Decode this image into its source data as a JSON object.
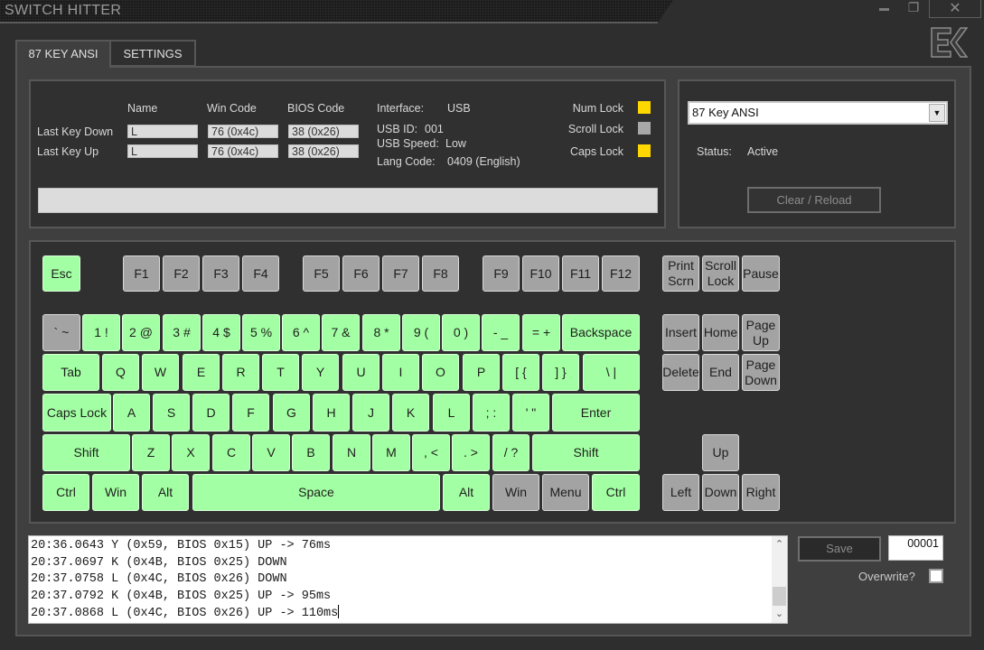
{
  "window": {
    "title": "SWITCH HITTER",
    "minimize_icon": "minimize-icon",
    "restore_icon": "restore-icon",
    "close_icon": "close-icon",
    "close_glyph": "✕",
    "restore_glyph": "❐",
    "logo": "EK"
  },
  "tabs": [
    {
      "label": "87 KEY ANSI",
      "active": true
    },
    {
      "label": "SETTINGS",
      "active": false
    }
  ],
  "info": {
    "columns": [
      "Name",
      "Win Code",
      "BIOS Code"
    ],
    "rows": [
      {
        "label": "Last Key Down",
        "name": "L",
        "win_code": "76 (0x4c)",
        "bios_code": "38 (0x26)"
      },
      {
        "label": "Last Key Up",
        "name": "L",
        "win_code": "76 (0x4c)",
        "bios_code": "38 (0x26)"
      }
    ],
    "interface_label": "Interface:",
    "interface_value": "USB",
    "usb_id_label": "USB ID:",
    "usb_id_value": "001",
    "usb_speed_label": "USB Speed:",
    "usb_speed_value": "Low",
    "lang_code_label": "Lang Code:",
    "lang_code_value": "0409 (English)",
    "locks": [
      {
        "label": "Num Lock",
        "on": true,
        "color": "#ffd700"
      },
      {
        "label": "Scroll Lock",
        "on": false,
        "color": "#a8a8a8"
      },
      {
        "label": "Caps Lock",
        "on": true,
        "color": "#ffd700"
      }
    ],
    "progress": 0
  },
  "device": {
    "layout_selected": "87 Key ANSI",
    "status_label": "Status:",
    "status_value": "Active",
    "clear_reload_label": "Clear / Reload"
  },
  "colors": {
    "key_tested": "#a3ffa3",
    "key_untested": "#a3a3a3",
    "lock_on": "#ffd700",
    "lock_off": "#a8a8a8"
  },
  "keyboard": {
    "keys": [
      {
        "id": "esc",
        "label": "Esc",
        "state": "tested"
      },
      {
        "id": "f1",
        "label": "F1",
        "state": "untested"
      },
      {
        "id": "f2",
        "label": "F2",
        "state": "untested"
      },
      {
        "id": "f3",
        "label": "F3",
        "state": "untested"
      },
      {
        "id": "f4",
        "label": "F4",
        "state": "untested"
      },
      {
        "id": "f5",
        "label": "F5",
        "state": "untested"
      },
      {
        "id": "f6",
        "label": "F6",
        "state": "untested"
      },
      {
        "id": "f7",
        "label": "F7",
        "state": "untested"
      },
      {
        "id": "f8",
        "label": "F8",
        "state": "untested"
      },
      {
        "id": "f9",
        "label": "F9",
        "state": "untested"
      },
      {
        "id": "f10",
        "label": "F10",
        "state": "untested"
      },
      {
        "id": "f11",
        "label": "F11",
        "state": "untested"
      },
      {
        "id": "f12",
        "label": "F12",
        "state": "untested"
      },
      {
        "id": "printscrn",
        "label": "Print Scrn",
        "state": "untested"
      },
      {
        "id": "scrolllock",
        "label": "Scroll Lock",
        "state": "untested"
      },
      {
        "id": "pause",
        "label": "Pause",
        "state": "untested"
      },
      {
        "id": "grave",
        "label": "` ~",
        "state": "untested"
      },
      {
        "id": "1",
        "label": "1 !",
        "state": "tested"
      },
      {
        "id": "2",
        "label": "2 @",
        "state": "tested"
      },
      {
        "id": "3",
        "label": "3 #",
        "state": "tested"
      },
      {
        "id": "4",
        "label": "4 $",
        "state": "tested"
      },
      {
        "id": "5",
        "label": "5 %",
        "state": "tested"
      },
      {
        "id": "6",
        "label": "6 ^",
        "state": "tested"
      },
      {
        "id": "7",
        "label": "7 &",
        "state": "tested"
      },
      {
        "id": "8",
        "label": "8 *",
        "state": "tested"
      },
      {
        "id": "9",
        "label": "9 (",
        "state": "tested"
      },
      {
        "id": "0",
        "label": "0 )",
        "state": "tested"
      },
      {
        "id": "minus",
        "label": "- _",
        "state": "tested"
      },
      {
        "id": "equal",
        "label": "= +",
        "state": "tested"
      },
      {
        "id": "backspace",
        "label": "Backspace",
        "state": "tested"
      },
      {
        "id": "insert",
        "label": "Insert",
        "state": "untested"
      },
      {
        "id": "home",
        "label": "Home",
        "state": "untested"
      },
      {
        "id": "pageup",
        "label": "Page Up",
        "state": "untested"
      },
      {
        "id": "tab",
        "label": "Tab",
        "state": "tested"
      },
      {
        "id": "q",
        "label": "Q",
        "state": "tested"
      },
      {
        "id": "w",
        "label": "W",
        "state": "tested"
      },
      {
        "id": "e",
        "label": "E",
        "state": "tested"
      },
      {
        "id": "r",
        "label": "R",
        "state": "tested"
      },
      {
        "id": "t",
        "label": "T",
        "state": "tested"
      },
      {
        "id": "y",
        "label": "Y",
        "state": "tested"
      },
      {
        "id": "u",
        "label": "U",
        "state": "tested"
      },
      {
        "id": "i",
        "label": "I",
        "state": "tested"
      },
      {
        "id": "o",
        "label": "O",
        "state": "tested"
      },
      {
        "id": "p",
        "label": "P",
        "state": "tested"
      },
      {
        "id": "lbracket",
        "label": "[ {",
        "state": "tested"
      },
      {
        "id": "rbracket",
        "label": "] }",
        "state": "tested"
      },
      {
        "id": "backslash",
        "label": "\\ |",
        "state": "tested"
      },
      {
        "id": "delete",
        "label": "Delete",
        "state": "untested"
      },
      {
        "id": "end",
        "label": "End",
        "state": "untested"
      },
      {
        "id": "pagedown",
        "label": "Page Down",
        "state": "untested"
      },
      {
        "id": "capslock",
        "label": "Caps Lock",
        "state": "tested"
      },
      {
        "id": "a",
        "label": "A",
        "state": "tested"
      },
      {
        "id": "s",
        "label": "S",
        "state": "tested"
      },
      {
        "id": "d",
        "label": "D",
        "state": "tested"
      },
      {
        "id": "f",
        "label": "F",
        "state": "tested"
      },
      {
        "id": "g",
        "label": "G",
        "state": "tested"
      },
      {
        "id": "h",
        "label": "H",
        "state": "tested"
      },
      {
        "id": "j",
        "label": "J",
        "state": "tested"
      },
      {
        "id": "k",
        "label": "K",
        "state": "tested"
      },
      {
        "id": "l",
        "label": "L",
        "state": "tested"
      },
      {
        "id": "semicolon",
        "label": "; :",
        "state": "tested"
      },
      {
        "id": "quote",
        "label": "' \"",
        "state": "tested"
      },
      {
        "id": "enter",
        "label": "Enter",
        "state": "tested"
      },
      {
        "id": "lshift",
        "label": "Shift",
        "state": "tested"
      },
      {
        "id": "z",
        "label": "Z",
        "state": "tested"
      },
      {
        "id": "x",
        "label": "X",
        "state": "tested"
      },
      {
        "id": "c",
        "label": "C",
        "state": "tested"
      },
      {
        "id": "v",
        "label": "V",
        "state": "tested"
      },
      {
        "id": "b",
        "label": "B",
        "state": "tested"
      },
      {
        "id": "n",
        "label": "N",
        "state": "tested"
      },
      {
        "id": "m",
        "label": "M",
        "state": "tested"
      },
      {
        "id": "comma",
        "label": ", <",
        "state": "tested"
      },
      {
        "id": "period",
        "label": ". >",
        "state": "tested"
      },
      {
        "id": "slash",
        "label": "/ ?",
        "state": "tested"
      },
      {
        "id": "rshift",
        "label": "Shift",
        "state": "tested"
      },
      {
        "id": "up",
        "label": "Up",
        "state": "untested"
      },
      {
        "id": "lctrl",
        "label": "Ctrl",
        "state": "tested"
      },
      {
        "id": "lwin",
        "label": "Win",
        "state": "tested"
      },
      {
        "id": "lalt",
        "label": "Alt",
        "state": "tested"
      },
      {
        "id": "space",
        "label": "Space",
        "state": "tested"
      },
      {
        "id": "ralt",
        "label": "Alt",
        "state": "tested"
      },
      {
        "id": "rwin",
        "label": "Win",
        "state": "untested"
      },
      {
        "id": "menu",
        "label": "Menu",
        "state": "untested"
      },
      {
        "id": "rctrl",
        "label": "Ctrl",
        "state": "tested"
      },
      {
        "id": "left",
        "label": "Left",
        "state": "untested"
      },
      {
        "id": "down",
        "label": "Down",
        "state": "untested"
      },
      {
        "id": "right",
        "label": "Right",
        "state": "untested"
      }
    ]
  },
  "log": {
    "lines": [
      "20:36.0643 Y (0x59, BIOS 0x15) UP -> 76ms",
      "20:37.0697 K (0x4B, BIOS 0x25) DOWN",
      "20:37.0758 L (0x4C, BIOS 0x26) DOWN",
      "20:37.0792 K (0x4B, BIOS 0x25) UP -> 95ms",
      "20:37.0868 L (0x4C, BIOS 0x26) UP -> 110ms"
    ],
    "scroll_up_glyph": "⌃",
    "scroll_down_glyph": "⌄"
  },
  "save": {
    "save_label": "Save",
    "counter_value": "00001",
    "overwrite_label": "Overwrite?",
    "overwrite_checked": false
  }
}
